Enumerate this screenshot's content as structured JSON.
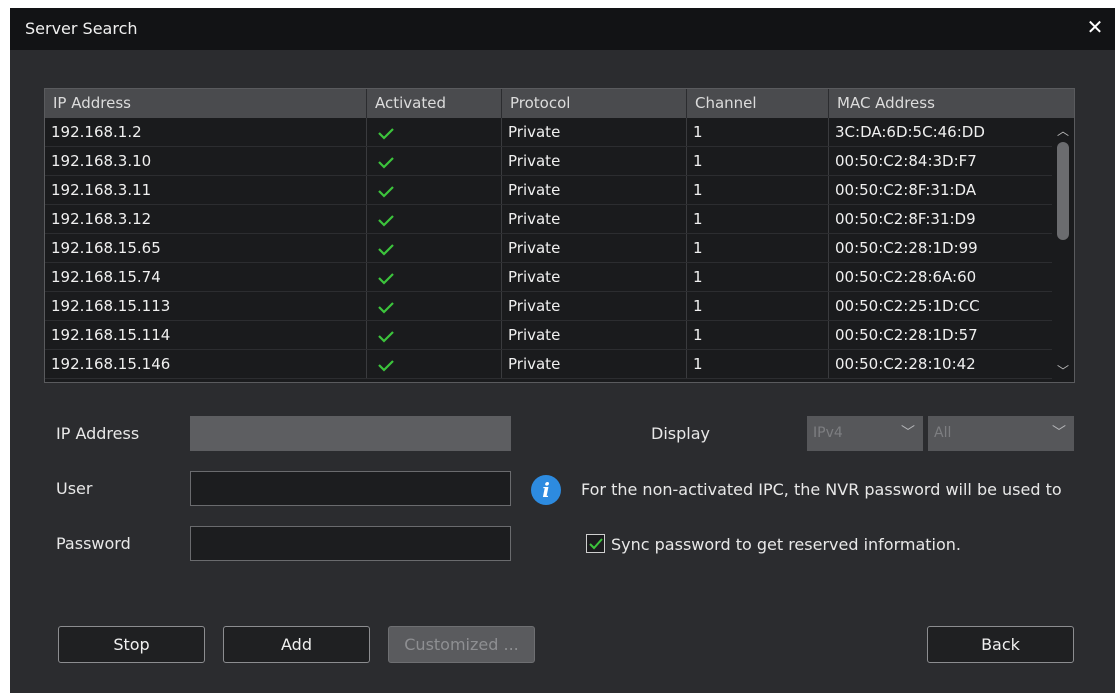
{
  "window": {
    "title": "Server Search"
  },
  "table": {
    "headers": [
      "IP Address",
      "Activated",
      "Protocol",
      "Channel",
      "MAC Address"
    ],
    "rows": [
      {
        "ip": "192.168.1.2",
        "activated": true,
        "protocol": "Private",
        "channel": "1",
        "mac": "3C:DA:6D:5C:46:DD"
      },
      {
        "ip": "192.168.3.10",
        "activated": true,
        "protocol": "Private",
        "channel": "1",
        "mac": "00:50:C2:84:3D:F7"
      },
      {
        "ip": "192.168.3.11",
        "activated": true,
        "protocol": "Private",
        "channel": "1",
        "mac": "00:50:C2:8F:31:DA"
      },
      {
        "ip": "192.168.3.12",
        "activated": true,
        "protocol": "Private",
        "channel": "1",
        "mac": "00:50:C2:8F:31:D9"
      },
      {
        "ip": "192.168.15.65",
        "activated": true,
        "protocol": "Private",
        "channel": "1",
        "mac": "00:50:C2:28:1D:99"
      },
      {
        "ip": "192.168.15.74",
        "activated": true,
        "protocol": "Private",
        "channel": "1",
        "mac": "00:50:C2:28:6A:60"
      },
      {
        "ip": "192.168.15.113",
        "activated": true,
        "protocol": "Private",
        "channel": "1",
        "mac": "00:50:C2:25:1D:CC"
      },
      {
        "ip": "192.168.15.114",
        "activated": true,
        "protocol": "Private",
        "channel": "1",
        "mac": "00:50:C2:28:1D:57"
      },
      {
        "ip": "192.168.15.146",
        "activated": true,
        "protocol": "Private",
        "channel": "1",
        "mac": "00:50:C2:28:10:42"
      }
    ]
  },
  "form": {
    "ip_label": "IP Address",
    "ip_value": "",
    "user_label": "User",
    "user_value": "",
    "password_label": "Password",
    "password_value": "",
    "display_label": "Display",
    "display_ip_version": "IPv4",
    "display_filter": "All",
    "info_text": "For the non-activated IPC, the NVR password will be used to",
    "sync_label": "Sync password to get reserved information.",
    "sync_checked": true
  },
  "buttons": {
    "stop": "Stop",
    "add": "Add",
    "customized": "Customized ...",
    "back": "Back"
  },
  "colors": {
    "check": "#3cc43c",
    "info": "#2d8be0"
  }
}
